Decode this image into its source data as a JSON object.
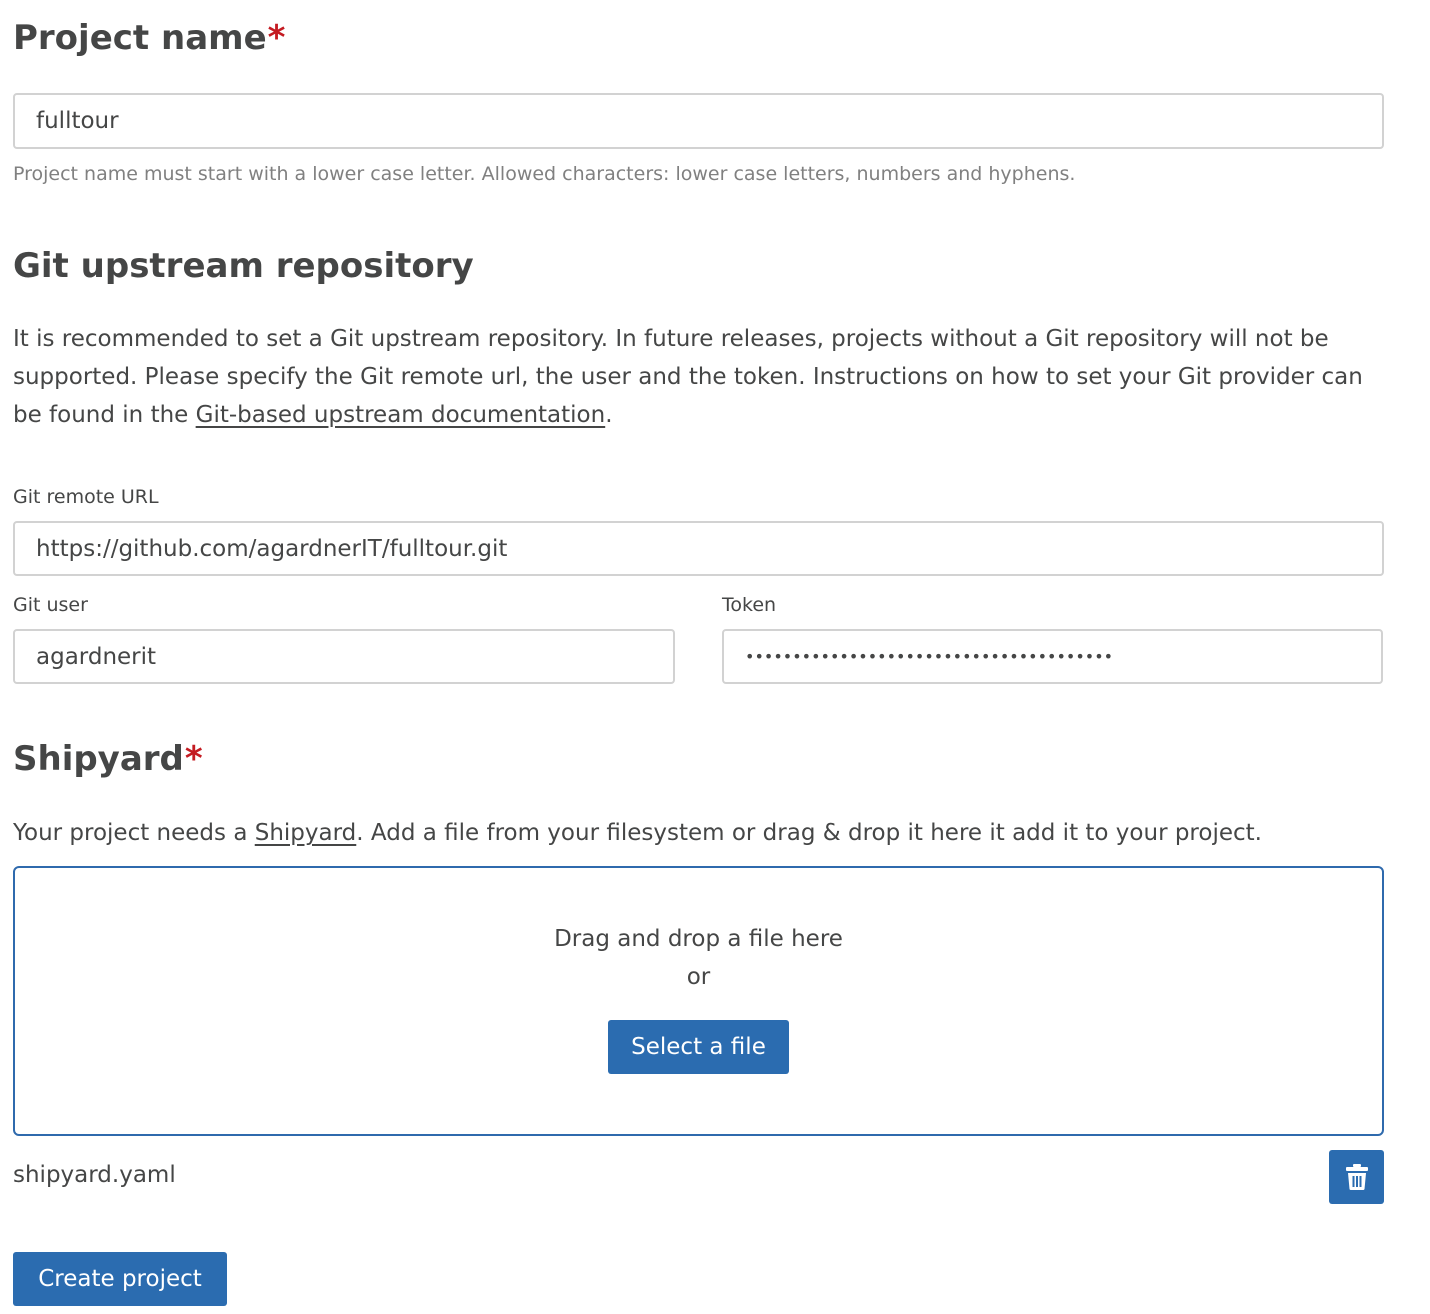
{
  "project_name": {
    "heading": "Project name",
    "required_marker": "*",
    "value": "fulltour",
    "hint": "Project name must start with a lower case letter. Allowed characters: lower case letters, numbers and hyphens."
  },
  "git": {
    "heading": "Git upstream repository",
    "description_before_link": "It is recommended to set a Git upstream repository. In future releases, projects without a Git repository will not be supported. Please specify the Git remote url, the user and the token. Instructions on how to set your Git provider can be found in the ",
    "description_link": "Git-based upstream documentation",
    "description_after_link": ".",
    "remote_url_label": "Git remote URL",
    "remote_url_value": "https://github.com/agardnerIT/fulltour.git",
    "user_label": "Git user",
    "user_value": "agardnerit",
    "token_label": "Token",
    "token_value": "•••••••••••••••••••••••••••••••••••••••"
  },
  "shipyard": {
    "heading": "Shipyard",
    "required_marker": "*",
    "description_before_link": "Your project needs a ",
    "description_link": "Shipyard",
    "description_after_link": ". Add a file from your filesystem or drag & drop it here it add it to your project.",
    "dropzone_line1": "Drag and drop a file here",
    "dropzone_line2": "or",
    "select_file_label": "Select a file",
    "selected_file_name": "shipyard.yaml",
    "delete_icon": "trash-icon"
  },
  "actions": {
    "create_label": "Create project"
  },
  "colors": {
    "primary": "#2b6cb0",
    "required": "#c41b22",
    "text": "#454646",
    "hint": "#808080",
    "border": "#d2d2d2"
  }
}
